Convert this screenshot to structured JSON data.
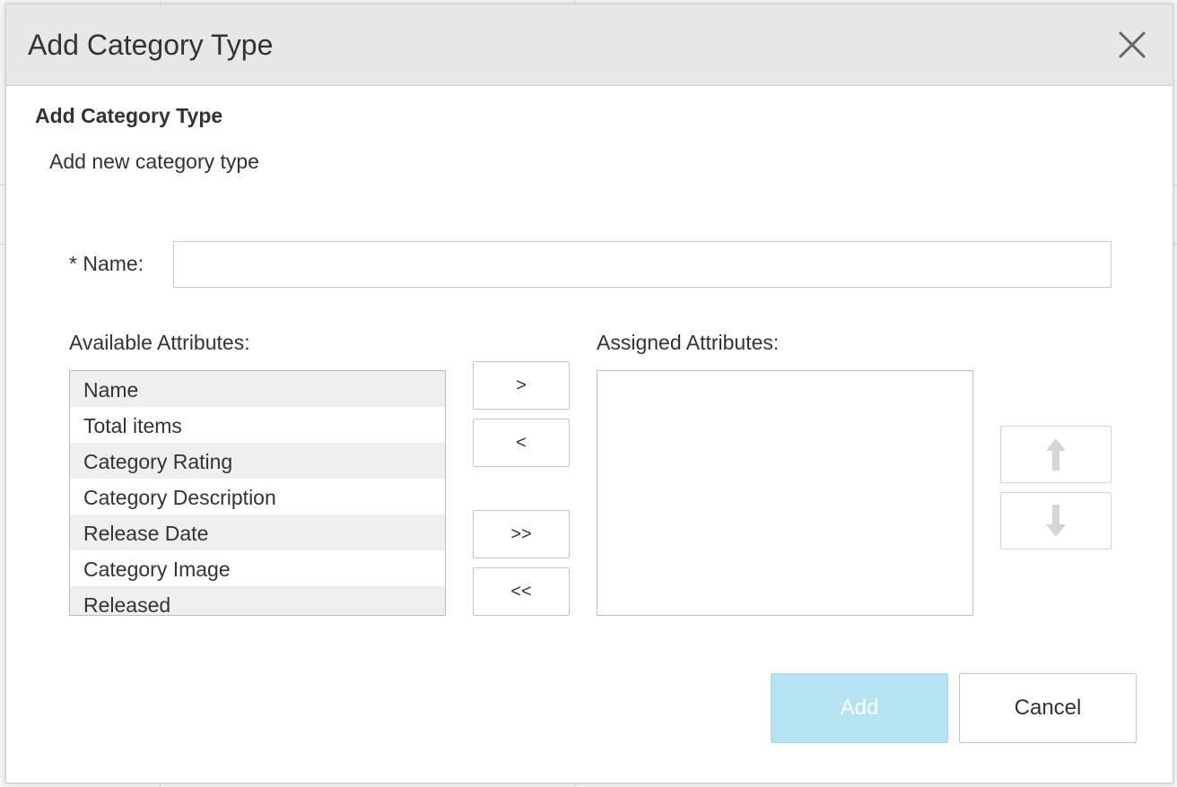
{
  "dialog": {
    "title": "Add Category Type",
    "close_icon": "close-icon"
  },
  "form": {
    "heading": "Add Category Type",
    "description": "Add new category type",
    "name_label": "* Name:",
    "name_value": "",
    "available_label": "Available Attributes:",
    "assigned_label": "Assigned Attributes:",
    "available_items": [
      "Name",
      "Total items",
      "Category Rating",
      "Category Description",
      "Release Date",
      "Category Image",
      "Released"
    ],
    "assigned_items": []
  },
  "transfer_buttons": {
    "add_one": ">",
    "remove_one": "<",
    "add_all": ">>",
    "remove_all": "<<"
  },
  "order_buttons": {
    "up_icon": "arrow-up-icon",
    "down_icon": "arrow-down-icon"
  },
  "footer": {
    "add_label": "Add",
    "cancel_label": "Cancel"
  },
  "colors": {
    "header_bg": "#e7e7e7",
    "primary_disabled": "#b6e3f4",
    "list_shade": "#efefef"
  }
}
